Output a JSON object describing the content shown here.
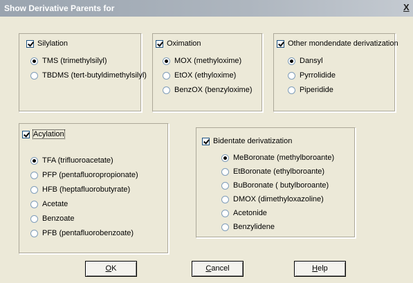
{
  "window": {
    "title": "Show Derivative Parents for",
    "close_label": "X"
  },
  "groups": {
    "silylation": {
      "label": "Silylation",
      "checked": true,
      "options": [
        {
          "label": "TMS (trimethylsilyl)",
          "selected": true
        },
        {
          "label": "TBDMS (tert-butyldimethylsilyl)",
          "selected": false
        }
      ]
    },
    "oximation": {
      "label": "Oximation",
      "checked": true,
      "options": [
        {
          "label": "MOX (methyloxime)",
          "selected": true
        },
        {
          "label": "EtOX (ethyloxime)",
          "selected": false
        },
        {
          "label": "BenzOX (benzyloxime)",
          "selected": false
        }
      ]
    },
    "other": {
      "label": "Other mondendate derivatization",
      "checked": true,
      "options": [
        {
          "label": "Dansyl",
          "selected": true
        },
        {
          "label": "Pyrrolidide",
          "selected": false
        },
        {
          "label": "Piperidide",
          "selected": false
        }
      ]
    },
    "acylation": {
      "label": "Acylation",
      "checked": true,
      "options": [
        {
          "label": "TFA (trifluoroacetate)",
          "selected": true
        },
        {
          "label": "PFP (pentafluoropropionate)",
          "selected": false
        },
        {
          "label": "HFB (heptafluorobutyrate)",
          "selected": false
        },
        {
          "label": "Acetate",
          "selected": false
        },
        {
          "label": "Benzoate",
          "selected": false
        },
        {
          "label": "PFB (pentafluorobenzoate)",
          "selected": false
        }
      ]
    },
    "bidentate": {
      "label": "Bidentate derivatization",
      "checked": true,
      "options": [
        {
          "label": "MeBoronate (methylboroante)",
          "selected": true
        },
        {
          "label": "EtBoronate  (ethylboroante)",
          "selected": false
        },
        {
          "label": "BuBoronate ( butylboroante)",
          "selected": false
        },
        {
          "label": "DMOX (dimethyloxazoline)",
          "selected": false
        },
        {
          "label": "Acetonide",
          "selected": false
        },
        {
          "label": "Benzylidene",
          "selected": false
        }
      ]
    }
  },
  "buttons": {
    "ok": {
      "mnemonic": "O",
      "rest": "K"
    },
    "cancel": {
      "mnemonic": "C",
      "rest": "ancel"
    },
    "help": {
      "mnemonic": "H",
      "rest": "elp"
    }
  }
}
